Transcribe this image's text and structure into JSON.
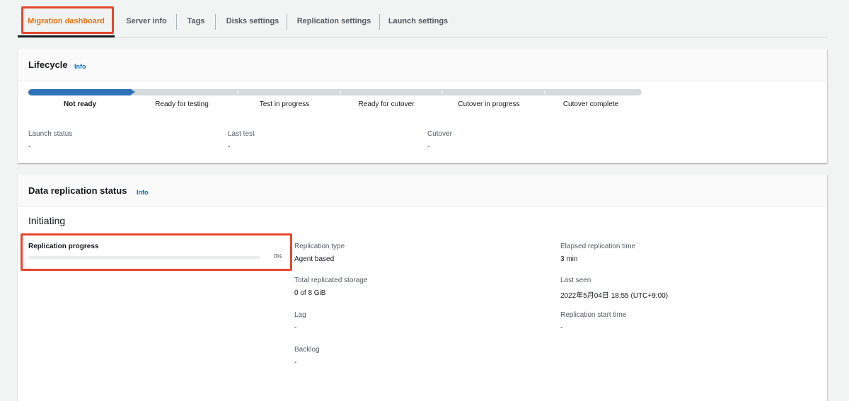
{
  "tabs": [
    {
      "label": "Migration dashboard",
      "active": true
    },
    {
      "label": "Server info"
    },
    {
      "label": "Tags"
    },
    {
      "label": "Disks settings"
    },
    {
      "label": "Replication settings"
    },
    {
      "label": "Launch settings"
    }
  ],
  "lifecycle": {
    "title": "Lifecycle",
    "info": "Info",
    "current_step_index": 0,
    "steps": [
      "Not ready",
      "Ready for testing",
      "Test in progress",
      "Ready for cutover",
      "Cutover in progress",
      "Cutover complete"
    ],
    "fields": [
      {
        "label": "Launch status",
        "value": "-"
      },
      {
        "label": "Last test",
        "value": "-"
      },
      {
        "label": "Cutover",
        "value": "-"
      }
    ]
  },
  "replication": {
    "title": "Data replication status",
    "info": "Info",
    "state": "Initiating",
    "progress_label": "Replication progress",
    "progress_percent": 0,
    "progress_text": "0%",
    "details_col1": [
      {
        "label": "Replication type",
        "value": "Agent based"
      },
      {
        "label": "Total replicated storage",
        "value": "0 of 8 GiB"
      },
      {
        "label": "Lag",
        "value": "-"
      },
      {
        "label": "Backlog",
        "value": "-"
      }
    ],
    "details_col2": [
      {
        "label": "Elapsed replication time",
        "value": "3 min"
      },
      {
        "label": "Last seen",
        "value": "2022年5月04日 18:55 (UTC+9:00)"
      },
      {
        "label": "Replication start time",
        "value": "-"
      }
    ]
  },
  "colors": {
    "accent_orange": "#ec7211",
    "highlight_red": "#e5472d",
    "progress_blue": "#2e73b8",
    "link_blue": "#0073bb"
  }
}
